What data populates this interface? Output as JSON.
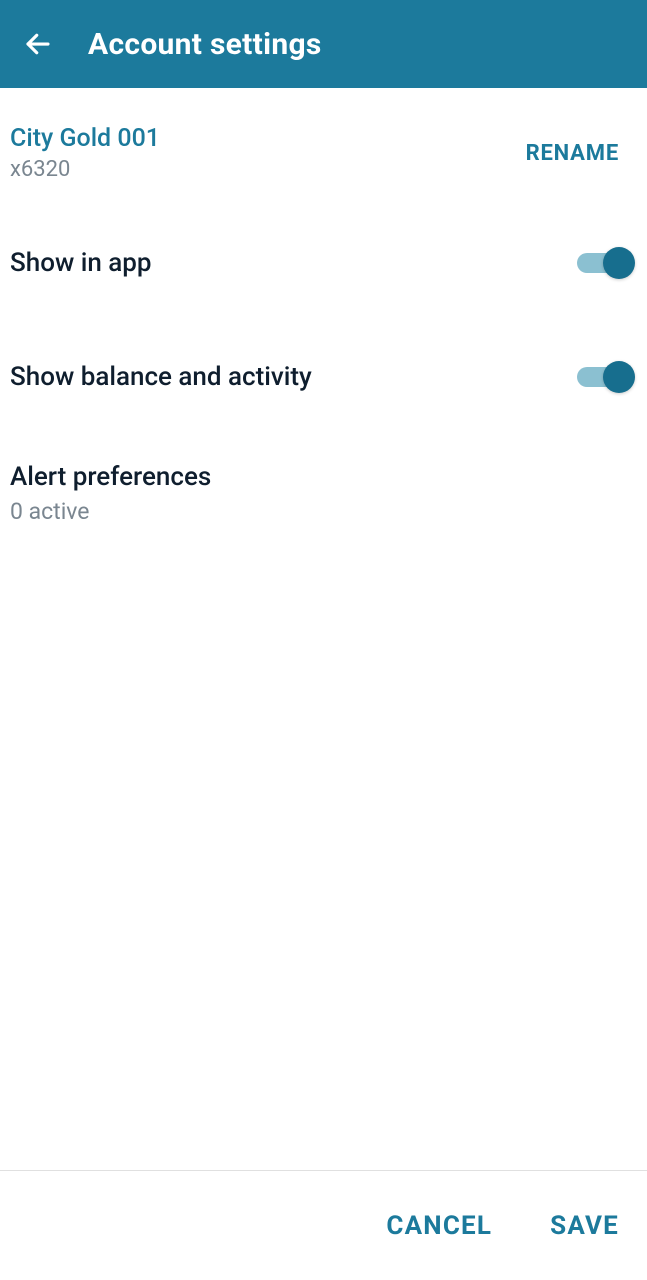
{
  "header": {
    "title": "Account settings"
  },
  "account": {
    "name": "City Gold 001",
    "number": "x6320",
    "rename_label": "RENAME"
  },
  "settings": {
    "show_in_app": {
      "label": "Show in app",
      "value": true
    },
    "show_balance": {
      "label": "Show balance and activity",
      "value": true
    }
  },
  "alerts": {
    "title": "Alert preferences",
    "subtitle": "0 active"
  },
  "footer": {
    "cancel_label": "CANCEL",
    "save_label": "SAVE"
  }
}
